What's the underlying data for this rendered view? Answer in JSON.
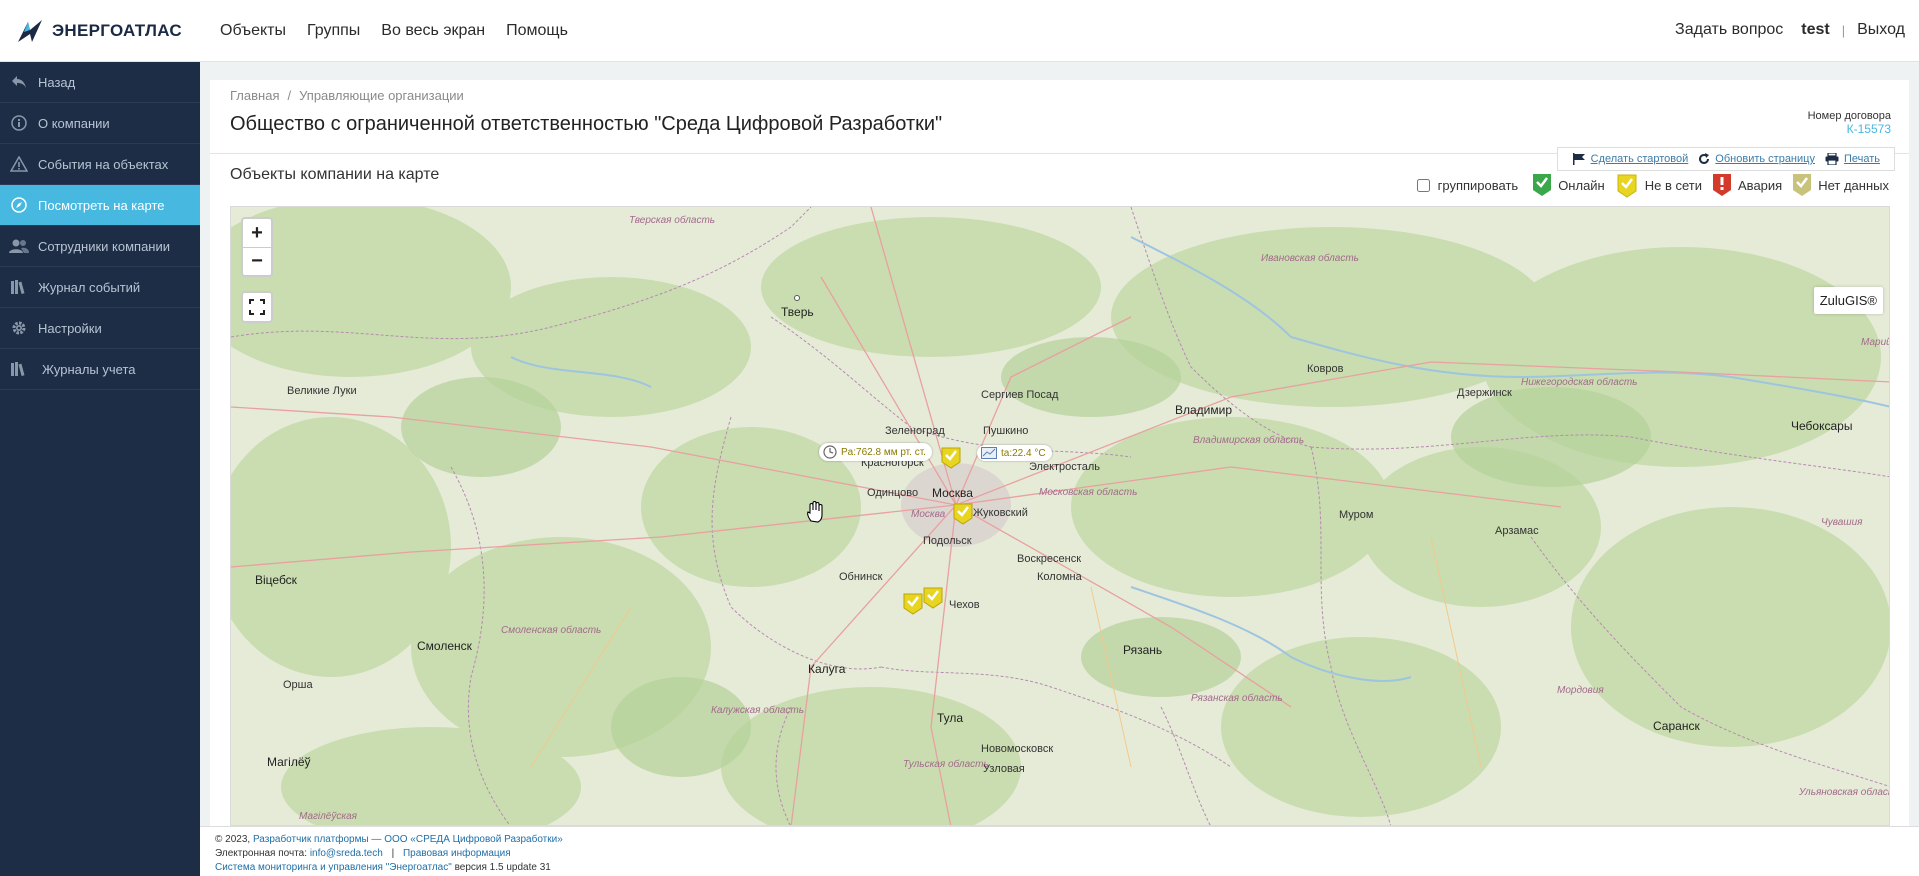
{
  "app": {
    "logo_text": "ЭНЕРГОАТЛАС"
  },
  "topnav": {
    "items": [
      "Объекты",
      "Группы",
      "Во весь экран",
      "Помощь"
    ],
    "ask": "Задать вопрос",
    "user": "test",
    "separator": "|",
    "logout": "Выход"
  },
  "sidebar": {
    "items": [
      {
        "label": "Назад",
        "icon": "back-arrow-icon"
      },
      {
        "label": "О компании",
        "icon": "info-icon"
      },
      {
        "label": "События на объектах",
        "icon": "warning-icon"
      },
      {
        "label": "Посмотреть на карте",
        "icon": "compass-icon",
        "active": true
      },
      {
        "label": "Сотрудники компании",
        "icon": "users-icon"
      },
      {
        "label": "Журнал событий",
        "icon": "books-icon"
      },
      {
        "label": "Настройки",
        "icon": "gear-icon"
      },
      {
        "label": "Журналы учета",
        "icon": "books-icon"
      }
    ],
    "active_color": "#47b8e0",
    "bg_color": "#1c2d45"
  },
  "breadcrumb": {
    "home": "Главная",
    "separator": "/",
    "current": "Управляющие организации"
  },
  "page": {
    "title": "Общество с ограниченной ответственностью \"Среда Цифровой Разработки\"",
    "contract_label": "Номер договора",
    "contract_number": "К-15573",
    "section_title": "Объекты компании на карте"
  },
  "toolbar": {
    "make_start": "Сделать стартовой",
    "refresh": "Обновить страницу",
    "print": "Печать"
  },
  "legend": {
    "group_label": "группировать",
    "group_checked": false,
    "items": [
      {
        "label": "Онлайн",
        "color": "#3aa84a"
      },
      {
        "label": "Не в сети",
        "color": "#e8d51f"
      },
      {
        "label": "Авария",
        "color": "#d33a2c"
      },
      {
        "label": "Нет данных",
        "color": "#c8c27a"
      }
    ]
  },
  "map": {
    "zoom_in": "+",
    "zoom_out": "−",
    "provider": "ZuluGIS®",
    "tooltips": {
      "pressure": "Pa:762.8 мм рт. ст.",
      "temperature": "ta:22.4 °C"
    },
    "cities": {
      "tver": "Тверь",
      "velikie_luki": "Великие Луки",
      "vitebsk": "Віцебск",
      "smolensk": "Смоленск",
      "orsha": "Орша",
      "mogilev": "Магілёў",
      "kaluga": "Калуга",
      "tula": "Тула",
      "obninsk": "Обнинск",
      "moscow": "Москва",
      "zelenograd": "Зеленоград",
      "pushkino": "Пушкино",
      "krasnogorsk": "Красногорск",
      "odintsovo": "Одинцово",
      "podolsk": "Подольск",
      "zhukovsky": "Жуковский",
      "elektrostal": "Электросталь",
      "sergiev_posad": "Сергиев Посад",
      "voskresensk": "Воскресенск",
      "kolomna": "Коломна",
      "ryazan": "Рязань",
      "novomoskovsk": "Новомосковск",
      "uzlovaya": "Узловая",
      "vladimir": "Владимир",
      "kovrov": "Ковров",
      "murom": "Муром",
      "arzamas": "Арзамас",
      "dzerzhinsk": "Дзержинск",
      "cheboksary": "Чебоксары",
      "saransk": "Саранск",
      "chekhov": "Чехов"
    },
    "regions": {
      "tver": "Тверская область",
      "ivanovo": "Ивановская область",
      "nizhny": "Нижегородская область",
      "vladimir": "Владимирская область",
      "moscow_obl": "Московская область",
      "moscow": "Москва",
      "smolensk": "Смоленская область",
      "kaluga": "Калужская область",
      "tula": "Тульская область",
      "ryazan": "Рязанская область",
      "mordovia": "Мордовия",
      "chuvashia": "Чувашия",
      "mari": "Марий",
      "ulyanovsk": "Ульяновская область",
      "mogilev": "Магілёўская"
    }
  },
  "footer": {
    "copyright": "© 2023,",
    "developer_link": "Разработчик платформы — ООО «СРЕДА Цифровой Разработки»",
    "email_label": "Электронная почта:",
    "email": "info@sreda.tech",
    "separator": "|",
    "legal": "Правовая информация",
    "system_link": "Система мониторинга и управления \"Энергоатлас\"",
    "version": "версия 1.5 update 31"
  }
}
